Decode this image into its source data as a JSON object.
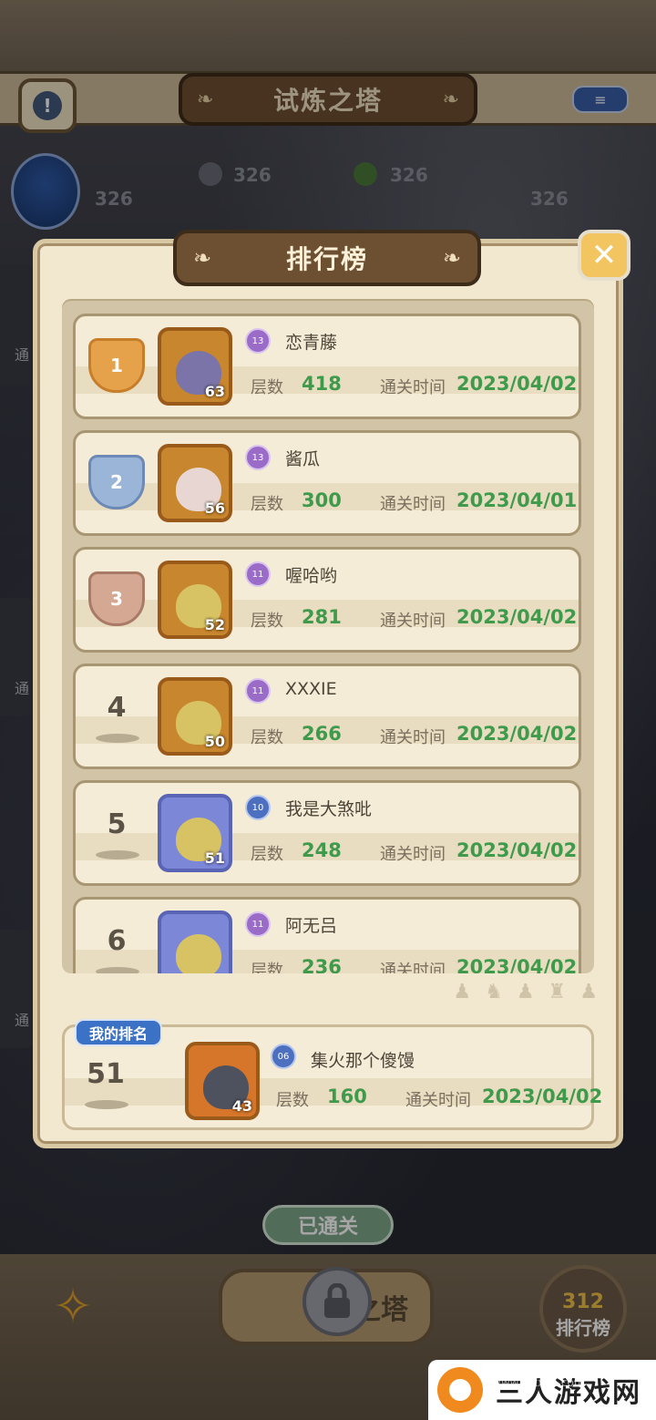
{
  "background": {
    "title": "试炼之塔",
    "info_icon": "info-icon",
    "menu_icon": "list-icon",
    "side_labels": [
      "通",
      "通",
      "通"
    ],
    "numbers": [
      "326",
      "326",
      "326",
      "326"
    ],
    "passed_label": "已通关",
    "tower_label": "之塔",
    "rank_button_digits": "312",
    "rank_button_label": "排行榜"
  },
  "modal": {
    "title": "排行榜",
    "close_icon": "close-icon",
    "floors_label": "层数",
    "time_label": "通关时间"
  },
  "rankings": [
    {
      "rank": "1",
      "name": "恋青藤",
      "level": "63",
      "badge": "13",
      "floors": "418",
      "date": "2023/04/02"
    },
    {
      "rank": "2",
      "name": "酱瓜",
      "level": "56",
      "badge": "13",
      "floors": "300",
      "date": "2023/04/01"
    },
    {
      "rank": "3",
      "name": "喔哈哟",
      "level": "52",
      "badge": "11",
      "floors": "281",
      "date": "2023/04/02"
    },
    {
      "rank": "4",
      "name": "XXXIE",
      "level": "50",
      "badge": "11",
      "floors": "266",
      "date": "2023/04/02"
    },
    {
      "rank": "5",
      "name": "我是大煞吡",
      "level": "51",
      "badge": "10",
      "floors": "248",
      "date": "2023/04/02"
    },
    {
      "rank": "6",
      "name": "阿无吕",
      "level": "",
      "badge": "11",
      "floors": "236",
      "date": "2023/04/02"
    }
  ],
  "my_rank": {
    "tag": "我的排名",
    "rank": "51",
    "name": "集火那个傻馒",
    "level": "43",
    "badge": "06",
    "floors": "160",
    "date": "2023/04/02"
  },
  "watermark": {
    "text": "三人游戏网",
    "url": "www.rskxxh.com"
  },
  "colors": {
    "accent_green": "#3f9a4c",
    "plate_brown": "#6d4f32",
    "panel_cream": "#f2e7cf",
    "close_yellow": "#f3c561",
    "my_rank_blue": "#3c72c6"
  }
}
